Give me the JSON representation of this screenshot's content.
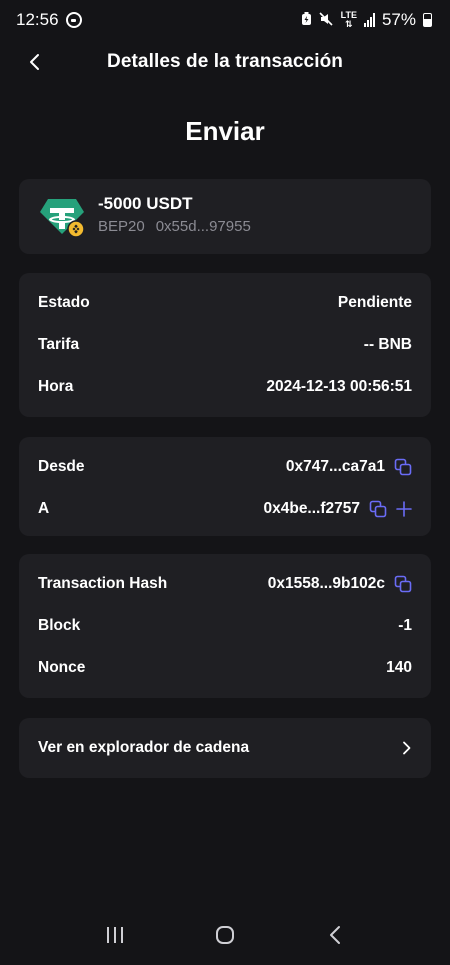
{
  "status_bar": {
    "time": "12:56",
    "battery": "57%",
    "network": "LTE"
  },
  "header": {
    "title": "Detalles de la transacción"
  },
  "transaction_type": "Enviar",
  "token": {
    "amount": "-5000 USDT",
    "network": "BEP20",
    "contract": "0x55d...97955",
    "icon": "tether-icon",
    "accent_color": "#26a17b"
  },
  "details": {
    "status_label": "Estado",
    "status_value": "Pendiente",
    "status_color": "#f0494c",
    "fee_label": "Tarifa",
    "fee_value": "-- BNB",
    "time_label": "Hora",
    "time_value": "2024-12-13 00:56:51"
  },
  "addresses": {
    "from_label": "Desde",
    "from_value": "0x747...ca7a1",
    "to_label": "A",
    "to_value": "0x4be...f2757",
    "icon_color": "#6a6cf6"
  },
  "chain": {
    "hash_label": "Transaction Hash",
    "hash_value": "0x1558...9b102c",
    "block_label": "Block",
    "block_value": "-1",
    "nonce_label": "Nonce",
    "nonce_value": "140"
  },
  "explorer": {
    "label": "Ver en explorador de cadena"
  }
}
